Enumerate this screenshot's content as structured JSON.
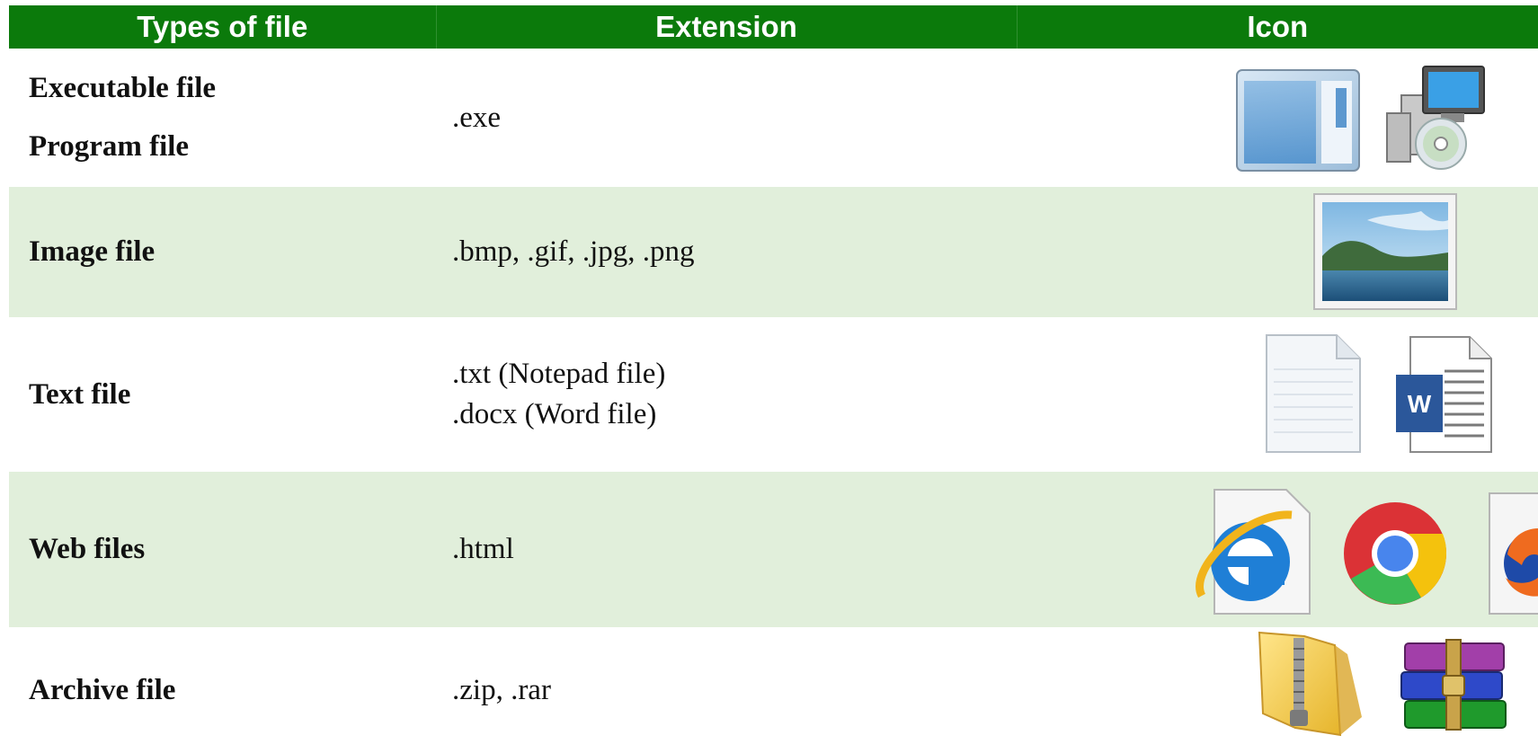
{
  "header": {
    "type_col": "Types of file",
    "ext_col": "Extension",
    "icon_col": "Icon"
  },
  "rows": [
    {
      "types": [
        "Executable file",
        "Program file"
      ],
      "extension": [
        ".exe"
      ],
      "icons": [
        "window-app-icon",
        "installer-disc-icon"
      ]
    },
    {
      "types": [
        "Image file"
      ],
      "extension": [
        ".bmp, .gif, .jpg, .png"
      ],
      "icons": [
        "landscape-image-icon"
      ]
    },
    {
      "types": [
        "Text file"
      ],
      "extension": [
        ".txt (Notepad file)",
        ".docx (Word file)"
      ],
      "icons": [
        "blank-text-document-icon",
        "word-document-icon"
      ]
    },
    {
      "types": [
        "Web files"
      ],
      "extension": [
        ".html"
      ],
      "icons": [
        "internet-explorer-icon",
        "chrome-icon",
        "firefox-icon"
      ]
    },
    {
      "types": [
        "Archive file"
      ],
      "extension": [
        ".zip, .rar"
      ],
      "icons": [
        "zip-folder-icon",
        "winrar-archive-icon"
      ]
    }
  ],
  "colors": {
    "header_bg": "#0b7a0b",
    "header_text": "#ffffff",
    "alt_row_bg": "#e1efdb"
  }
}
